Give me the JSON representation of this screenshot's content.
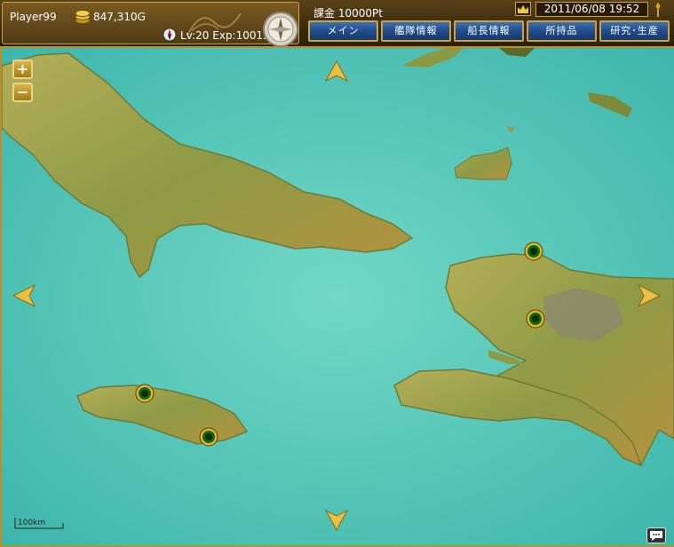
{
  "player": {
    "name": "Player99",
    "gold": "847,310G",
    "level_exp": "Lv:20 Exp:10015"
  },
  "premium": {
    "points": "課金 10000Pt"
  },
  "datetime": "2011/06/08 19:52",
  "tabs": [
    {
      "label": "メイン"
    },
    {
      "label": "艦隊情報"
    },
    {
      "label": "船長情報"
    },
    {
      "label": "所持品"
    },
    {
      "label": "研究･生産"
    }
  ],
  "map": {
    "zoom_in": "+",
    "zoom_out": "−",
    "scale_label": "100km",
    "sea_color": "#52c3b5",
    "land_color": "#a8a650",
    "icons": [
      "coin-icon",
      "compass-icon",
      "crown-icon",
      "torch-icon",
      "arrow-up-icon",
      "arrow-down-icon",
      "arrow-left-icon",
      "arrow-right-icon",
      "port-icon",
      "chat-icon"
    ]
  }
}
